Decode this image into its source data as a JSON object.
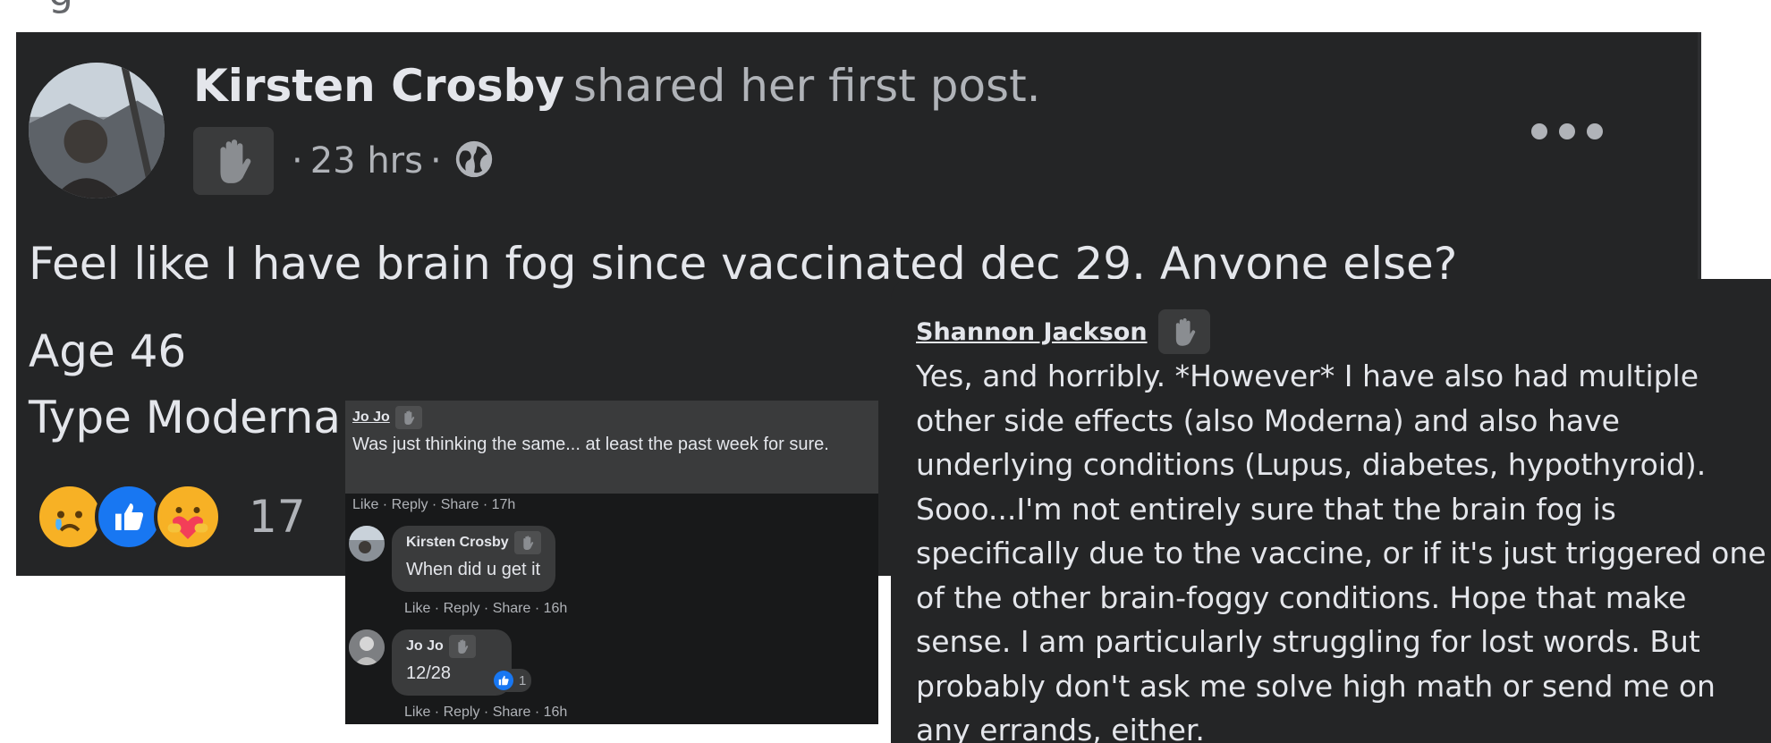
{
  "top_strip": {
    "cut_text": "g"
  },
  "post": {
    "author": "Kirsten Crosby",
    "action": "shared her first post.",
    "time": "23 hrs",
    "separator": "·",
    "body_line1": "Feel like I have brain fog since vaccinated dec 29.  Anyone else?",
    "body_line2": "Age 46",
    "body_line3": "Type Moderna",
    "reaction_count": "17",
    "icons": [
      "wave-badge-icon",
      "globe-icon",
      "more-icon",
      "sad-reaction-icon",
      "like-reaction-icon",
      "care-reaction-icon"
    ]
  },
  "thread": {
    "top_comment": {
      "author": "Jo Jo",
      "text": "Was just thinking the same... at least the past week for sure.",
      "actions": "Like · Reply · Share · 17h"
    },
    "reply1": {
      "author": "Kirsten Crosby",
      "text": "When did u get it",
      "actions": "Like · Reply · Share · 16h"
    },
    "reply2": {
      "author": "Jo Jo",
      "text": "12/28",
      "like_count": "1",
      "actions": "Like · Reply · Share · 16h"
    }
  },
  "shannon": {
    "author": "Shannon Jackson",
    "lines": [
      "Yes, and horribly. *However* I have also had multiple",
      "other side effects (also Moderna) and also have",
      "underlying conditions (Lupus, diabetes, hypothyroid).",
      "Sooo...I'm not entirely sure that the brain fog is",
      "specifically due to the vaccine, or if it's just triggered one",
      "of the other brain-foggy conditions. Hope that make",
      "sense. I am particularly struggling for lost words. But",
      "probably don't ask me solve high math or send me on",
      "any errands, either."
    ]
  }
}
